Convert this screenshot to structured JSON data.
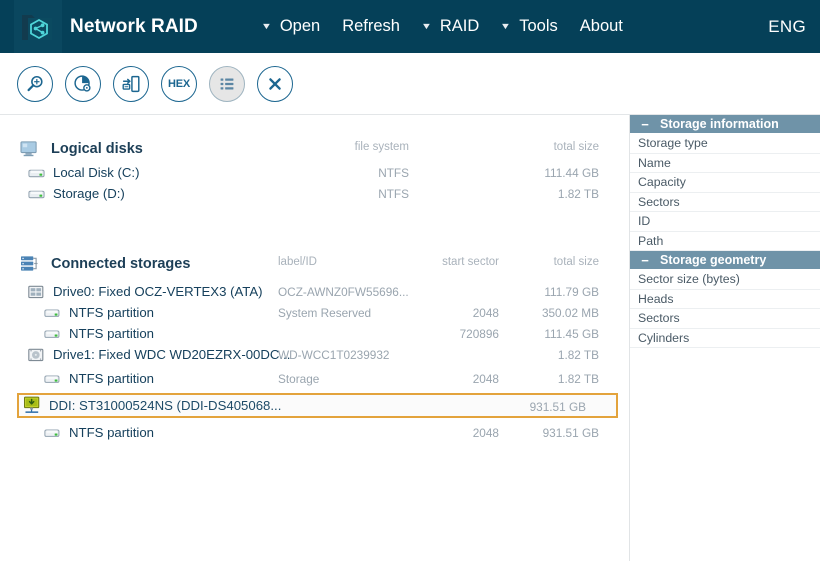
{
  "header": {
    "app_title": "Network RAID",
    "logo_icon": "network-folder-logo",
    "language": "ENG",
    "menu": [
      {
        "label": "Open",
        "has_caret": true,
        "icon": "chevron-down-icon"
      },
      {
        "label": "Refresh",
        "has_caret": false,
        "icon": ""
      },
      {
        "label": "RAID",
        "has_caret": true,
        "icon": "chevron-down-icon"
      },
      {
        "label": "Tools",
        "has_caret": true,
        "icon": "chevron-down-icon"
      },
      {
        "label": "About",
        "has_caret": false,
        "icon": ""
      }
    ]
  },
  "toolbar": {
    "buttons": [
      {
        "name": "find-icon",
        "label": "",
        "active": false
      },
      {
        "name": "disk-scan-icon",
        "label": "",
        "active": false
      },
      {
        "name": "copy-disk-icon",
        "label": "",
        "active": false
      },
      {
        "name": "hex-viewer-icon",
        "label": "HEX",
        "active": false
      },
      {
        "name": "list-view-icon",
        "label": "",
        "active": true
      },
      {
        "name": "close-icon",
        "label": "",
        "active": false
      }
    ]
  },
  "logical_disks": {
    "title": "Logical disks",
    "icon": "monitor-icon",
    "columns": {
      "file_system": "file system",
      "total_size": "total size"
    },
    "rows": [
      {
        "icon": "disk-icon",
        "label": "Local Disk (C:)",
        "file_system": "NTFS",
        "total_size": "111.44 GB"
      },
      {
        "icon": "disk-icon",
        "label": "Storage (D:)",
        "file_system": "NTFS",
        "total_size": "1.82 TB"
      }
    ]
  },
  "connected_storages": {
    "title": "Connected storages",
    "icon": "server-stack-icon",
    "columns": {
      "label_id": "label/ID",
      "start_sector": "start sector",
      "total_size": "total size"
    },
    "rows": [
      {
        "icon": "ssd-icon",
        "label": "Drive0: Fixed OCZ-VERTEX3 (ATA)",
        "label_id": "OCZ-AWNZ0FW55696...",
        "start_sector": "",
        "total_size": "111.79 GB",
        "level": 1,
        "selected": false
      },
      {
        "icon": "partition-icon",
        "label": "NTFS partition",
        "label_id": "System Reserved",
        "start_sector": "2048",
        "total_size": "350.02 MB",
        "level": 2,
        "selected": false
      },
      {
        "icon": "partition-icon",
        "label": "NTFS partition",
        "label_id": "",
        "start_sector": "720896",
        "total_size": "111.45 GB",
        "level": 2,
        "selected": false
      },
      {
        "icon": "hdd-icon",
        "label": "Drive1: Fixed WDC WD20EZRX-00DC...",
        "label_id": "WD-WCC1T0239932",
        "start_sector": "",
        "total_size": "1.82 TB",
        "level": 1,
        "selected": false
      },
      {
        "icon": "partition-icon",
        "label": "NTFS partition",
        "label_id": "Storage",
        "start_sector": "2048",
        "total_size": "1.82 TB",
        "level": 2,
        "selected": false
      },
      {
        "icon": "network-disk-icon",
        "label": "DDI: ST31000524NS (DDI-DS405068...",
        "label_id": "",
        "start_sector": "",
        "total_size": "931.51 GB",
        "level": 1,
        "selected": true
      },
      {
        "icon": "partition-icon",
        "label": "NTFS partition",
        "label_id": "",
        "start_sector": "2048",
        "total_size": "931.51 GB",
        "level": 2,
        "selected": false
      }
    ]
  },
  "inspector": {
    "groups": [
      {
        "title": "Storage information",
        "collapse_icon": "minus-icon",
        "rows": [
          {
            "name": "Storage type",
            "value": ""
          },
          {
            "name": "Name",
            "value": ""
          },
          {
            "name": "Capacity",
            "value": ""
          },
          {
            "name": "Sectors",
            "value": ""
          },
          {
            "name": "ID",
            "value": ""
          },
          {
            "name": "Path",
            "value": ""
          }
        ]
      },
      {
        "title": "Storage geometry",
        "collapse_icon": "minus-icon",
        "rows": [
          {
            "name": "Sector size (bytes)",
            "value": ""
          },
          {
            "name": "Heads",
            "value": ""
          },
          {
            "name": "Sectors",
            "value": ""
          },
          {
            "name": "Cylinders",
            "value": ""
          }
        ]
      }
    ]
  },
  "colors": {
    "header_bg": "#054058",
    "logo_plate": "#0a475f",
    "accent_blue": "#1c6690",
    "panel_header": "#6f93a8",
    "selection_border": "#e3a33c",
    "text_primary": "#16405c",
    "text_muted": "#9aa5af"
  }
}
